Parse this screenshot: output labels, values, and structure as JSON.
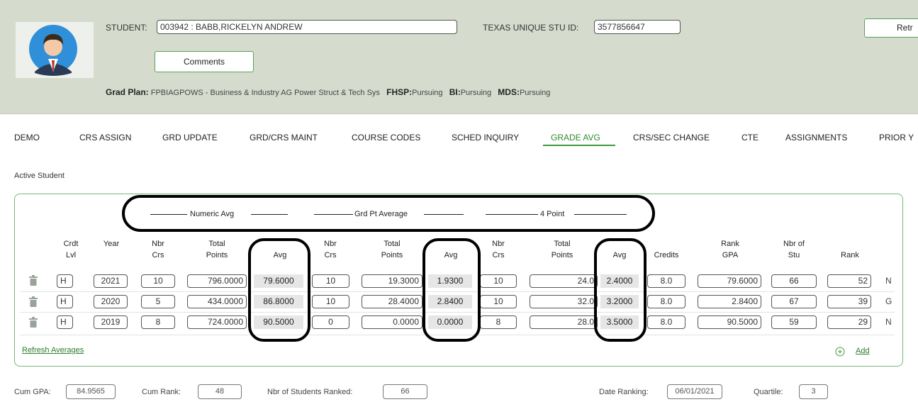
{
  "header": {
    "student_label": "STUDENT:",
    "student_value": "003942 : BABB,RICKELYN ANDREW",
    "texas_id_label": "TEXAS UNIQUE STU ID:",
    "texas_id_value": "3577856647",
    "comments_button": "Comments",
    "retrieve_button": "Retr",
    "grad_plan_label": "Grad Plan:",
    "grad_plan_value": "FPBIAGPOWS - Business & Industry AG Power Struct & Tech Sys",
    "fhsp_label": "FHSP:",
    "fhsp_value": "Pursuing",
    "bi_label": "BI:",
    "bi_value": "Pursuing",
    "mds_label": "MDS:",
    "mds_value": "Pursuing"
  },
  "tabs": [
    "DEMO",
    "CRS ASSIGN",
    "GRD UPDATE",
    "GRD/CRS MAINT",
    "COURSE CODES",
    "SCHED INQUIRY",
    "GRADE AVG",
    "CRS/SEC CHANGE",
    "CTE",
    "ASSIGNMENTS",
    "PRIOR Y"
  ],
  "active_tab": "GRADE AVG",
  "status_text": "Active Student",
  "groups": {
    "numeric": "Numeric Avg",
    "grdpt": "Grd Pt Average",
    "four": "4 Point"
  },
  "columns": {
    "crdt_lvl": [
      "Crdt",
      "Lvl"
    ],
    "year": [
      "",
      "Year"
    ],
    "num_nbr_crs": [
      "Nbr",
      "Crs"
    ],
    "num_total": [
      "Total",
      "Points"
    ],
    "num_avg": [
      "",
      "Avg"
    ],
    "gp_nbr_crs": [
      "Nbr",
      "Crs"
    ],
    "gp_total": [
      "Total",
      "Points"
    ],
    "gp_avg": [
      "",
      "Avg"
    ],
    "fp_nbr_crs": [
      "Nbr",
      "Crs"
    ],
    "fp_total": [
      "Total",
      "Points"
    ],
    "fp_avg": [
      "",
      "Avg"
    ],
    "credits": [
      "",
      "Credits"
    ],
    "rank_gpa": [
      "Rank",
      "GPA"
    ],
    "nbr_stu": [
      "Nbr of",
      "Stu"
    ],
    "rank": [
      "",
      "Rank"
    ]
  },
  "rows": [
    {
      "crdt": "H",
      "year": "2021",
      "n_nbr": "10",
      "n_total": "796.0000",
      "n_avg": "79.6000",
      "g_nbr": "10",
      "g_total": "19.3000",
      "g_avg": "1.9300",
      "f_nbr": "10",
      "f_total": "24.0",
      "f_avg": "2.4000",
      "credits": "8.0",
      "rank_gpa": "79.6000",
      "nbr_stu": "66",
      "rank": "52",
      "flag": "N"
    },
    {
      "crdt": "H",
      "year": "2020",
      "n_nbr": "5",
      "n_total": "434.0000",
      "n_avg": "86.8000",
      "g_nbr": "10",
      "g_total": "28.4000",
      "g_avg": "2.8400",
      "f_nbr": "10",
      "f_total": "32.0",
      "f_avg": "3.2000",
      "credits": "8.0",
      "rank_gpa": "2.8400",
      "nbr_stu": "67",
      "rank": "39",
      "flag": "G"
    },
    {
      "crdt": "H",
      "year": "2019",
      "n_nbr": "8",
      "n_total": "724.0000",
      "n_avg": "90.5000",
      "g_nbr": "0",
      "g_total": "0.0000",
      "g_avg": "0.0000",
      "f_nbr": "8",
      "f_total": "28.0",
      "f_avg": "3.5000",
      "credits": "8.0",
      "rank_gpa": "90.5000",
      "nbr_stu": "59",
      "rank": "29",
      "flag": "N"
    }
  ],
  "refresh_link": "Refresh Averages",
  "add_link": "Add",
  "footer": {
    "cum_gpa_label": "Cum GPA:",
    "cum_gpa_value": "84.9565",
    "cum_rank_label": "Cum Rank:",
    "cum_rank_value": "48",
    "nbr_ranked_label": "Nbr of Students Ranked:",
    "nbr_ranked_value": "66",
    "date_ranking_label": "Date Ranking:",
    "date_ranking_value": "06/01/2021",
    "quartile_label": "Quartile:",
    "quartile_value": "3"
  },
  "colors": {
    "header_bg": "#d6dccd",
    "accent_green": "#3a9a3a",
    "panel_border": "#78b878"
  }
}
